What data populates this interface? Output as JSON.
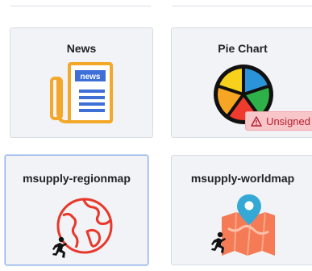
{
  "plugins": [
    {
      "name": "News",
      "icon": "newspaper-icon"
    },
    {
      "name": "Pie Chart",
      "icon": "pie-chart-icon",
      "badge": {
        "label": "Unsigned",
        "icon": "warning-triangle-icon"
      }
    },
    {
      "name": "msupply-regionmap",
      "icon": "globe-icon",
      "sub_icon": "person-running-icon"
    },
    {
      "name": "msupply-worldmap",
      "icon": "map-pin-icon",
      "sub_icon": "person-running-icon"
    }
  ],
  "colors": {
    "card_bg": "#f1f3f6",
    "news_orange": "#f3a82a",
    "news_blue": "#3d6fd6",
    "globe_red": "#e8382b",
    "map_orange": "#f47b55",
    "pin_blue": "#35a9d6",
    "badge_bg": "#f8c6c9",
    "badge_text": "#b5202f"
  }
}
